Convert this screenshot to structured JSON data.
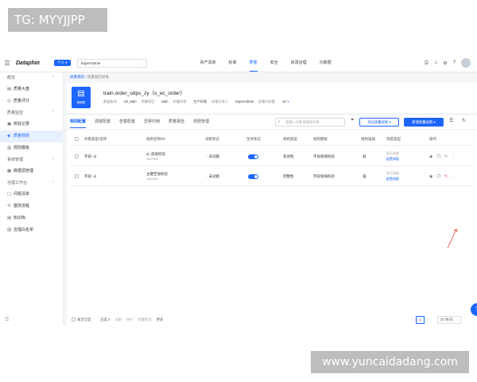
{
  "watermarks": {
    "top": "TG: MYYJJPP",
    "bottom": "www.yuncaidadang.com"
  },
  "topbar": {
    "logo": "Dataphin",
    "scope_button": "个人 ▾",
    "project_select": "SuperAdmin",
    "nav": [
      "资产清单",
      "标准",
      "质量",
      "安全",
      "资源治理",
      "元数据"
    ],
    "active_nav_index": 2,
    "icons": [
      "download-icon",
      "bell-icon",
      "tool-icon",
      "help-icon",
      "avatar"
    ]
  },
  "sidebar": {
    "groups": [
      {
        "label": "概览",
        "items": [
          {
            "label": "质量大盘",
            "icon": "dashboard-icon"
          },
          {
            "label": "质量评分",
            "icon": "score-icon"
          }
        ]
      },
      {
        "label": "质量监控",
        "items": [
          {
            "label": "校验记录",
            "icon": "record-icon"
          },
          {
            "label": "质量规则",
            "icon": "rule-icon",
            "active": true
          },
          {
            "label": "规则模板",
            "icon": "template-icon"
          }
        ]
      },
      {
        "label": "系统管理",
        "items": [
          {
            "label": "数据源管理",
            "icon": "datasource-icon"
          }
        ]
      },
      {
        "label": "治理工作台",
        "items": [
          {
            "label": "问题清单",
            "icon": "issue-icon"
          },
          {
            "label": "整改流程",
            "icon": "flow-icon"
          },
          {
            "label": "知识库",
            "icon": "knowledge-icon"
          },
          {
            "label": "治理白名单",
            "icon": "whitelist-icon"
          }
        ]
      }
    ]
  },
  "breadcrumb": {
    "parent": "质量规则",
    "separator": "/",
    "current": "质量规则详情"
  },
  "header": {
    "icon_label": "物理表",
    "table_name": "train.order_odps_zy（s_ec_order）",
    "meta": [
      {
        "key": "数据板块",
        "value": "LD_train"
      },
      {
        "key": "所属项目",
        "value": "train"
      },
      {
        "key": "所属环境",
        "value": "生产环境"
      },
      {
        "key": "质量负责人",
        "value": "SuperAdmin"
      },
      {
        "key": "质量分权重",
        "value": "10"
      }
    ]
  },
  "tabs": [
    "规则配置",
    "调度配置",
    "告警配置",
    "异常归档",
    "质量报告",
    "权限管理"
  ],
  "active_tab_index": 0,
  "toolbar": {
    "search_placeholder": "请输入对象或规则名称",
    "export_label": "导出质量规则 ▾",
    "new_label": "新建质量规则 ▾"
  },
  "table": {
    "columns": [
      "对象类型/名称",
      "规则名称/ID",
      "试跑状态",
      "生效状态",
      "规则类型",
      "规则模板",
      "规则强弱",
      "调度类型",
      "操作"
    ],
    "rows": [
      {
        "object": "字段: id",
        "rule_name": "id_值域校验",
        "rule_id": "4349982",
        "trial_status": "未试跑",
        "enabled": true,
        "rule_type": "有效性",
        "template": "字段值域校验",
        "strength": "弱",
        "schedule_line1": "暂无调度",
        "schedule_line2": "配置调度"
      },
      {
        "object": "字段: id",
        "rule_name": "主键空值校验",
        "rule_id": "2646329",
        "trial_status": "未试跑",
        "enabled": true,
        "rule_type": "完整性",
        "template": "字段值域校验",
        "strength": "强",
        "schedule_line1": "暂无调度",
        "schedule_line2": "配置调度"
      }
    ],
    "row_actions": [
      "view-icon",
      "copy-icon",
      "edit-icon",
      "more-icon"
    ]
  },
  "footer": {
    "select_page": "本页全选",
    "selected": "已选 0",
    "actions": [
      "试跑",
      "执行",
      "批量修改",
      "更多"
    ],
    "current_page": "1",
    "per_page": "20 条/页"
  },
  "colors": {
    "accent": "#1c66ff",
    "highlight": "#e0443a"
  }
}
